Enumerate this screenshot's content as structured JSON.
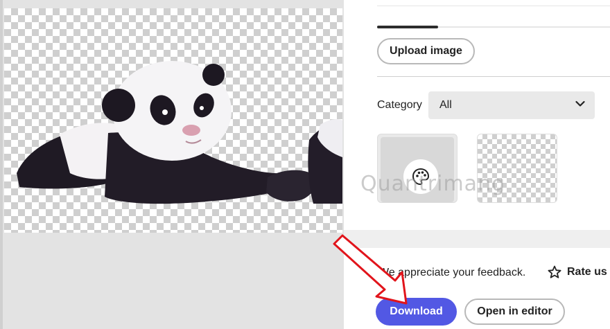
{
  "panel": {
    "upload_label": "Upload image",
    "category_label": "Category",
    "category_value": "All",
    "feedback_text": "We appreciate your feedback.",
    "rate_label": "Rate us",
    "download_label": "Download",
    "open_editor_label": "Open in editor"
  },
  "watermark": "Quantrimang",
  "icons": {
    "category_chevron": "chevron-down-icon",
    "thumb_palette": "palette-icon",
    "rate": "star-icon"
  },
  "colors": {
    "download_bg": "#5258e4",
    "annotation_arrow": "#e1141b"
  }
}
